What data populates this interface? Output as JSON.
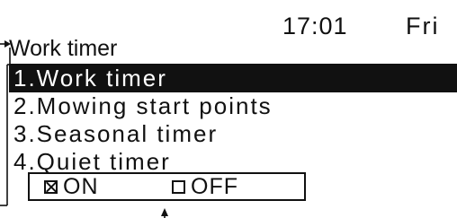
{
  "status_bar": {
    "time": "17:01",
    "day": "Fri"
  },
  "screen": {
    "title": "Work timer"
  },
  "menu": {
    "items": [
      {
        "label": "1.Work timer",
        "selected": true
      },
      {
        "label": "2.Mowing start points",
        "selected": false
      },
      {
        "label": "3.Seasonal timer",
        "selected": false
      },
      {
        "label": "4.Quiet timer",
        "selected": false
      }
    ]
  },
  "quiet_timer_toggle": {
    "on_label": "ON",
    "off_label": "OFF",
    "value": "ON"
  },
  "colors": {
    "foreground": "#111111",
    "background": "#ffffff",
    "highlight_text": "#ffffff"
  }
}
